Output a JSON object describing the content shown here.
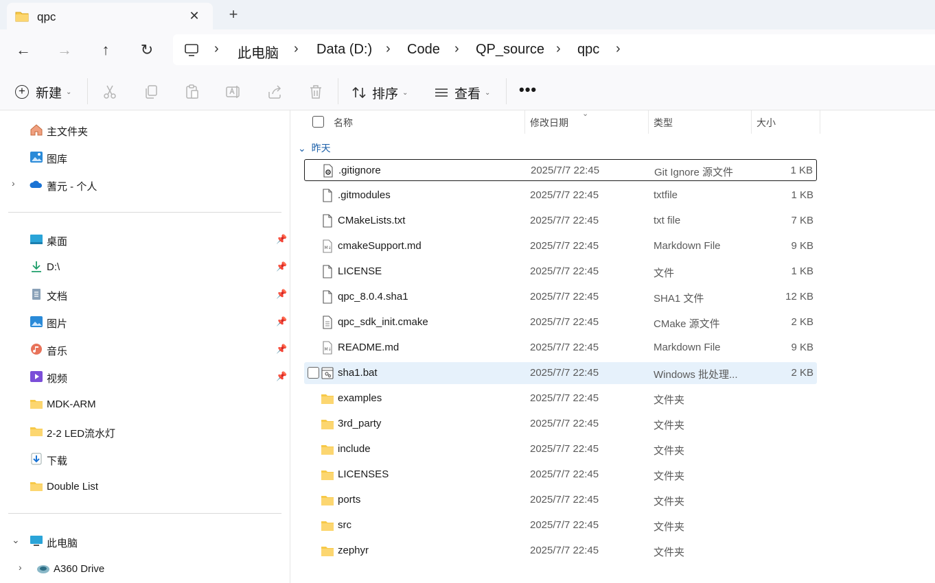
{
  "tab": {
    "title": "qpc",
    "close": "✕",
    "new": "+"
  },
  "nav": {
    "back": "←",
    "forward": "→",
    "up": "↑",
    "refresh": "↻"
  },
  "breadcrumbs": [
    "此电脑",
    "Data (D:)",
    "Code",
    "QP_source",
    "qpc"
  ],
  "breadcrumb_separator": "›",
  "commands": {
    "new_label": "新建",
    "sort_label": "排序",
    "view_label": "查看",
    "more": "•••",
    "icons": [
      "cut-icon",
      "copy-icon",
      "paste-icon",
      "rename-icon",
      "share-icon",
      "delete-icon"
    ]
  },
  "sidebar": {
    "top": [
      {
        "label": "主文件夹",
        "icon": "home-icon"
      },
      {
        "label": "图库",
        "icon": "gallery-icon"
      },
      {
        "label": "蓍元 - 个人",
        "icon": "onedrive-icon",
        "expander": "›"
      }
    ],
    "quick": [
      {
        "label": "桌面",
        "icon": "desktop-icon",
        "pinned": true
      },
      {
        "label": "D:\\",
        "icon": "download-arrow-icon",
        "pinned": true
      },
      {
        "label": "文档",
        "icon": "document-icon",
        "pinned": true
      },
      {
        "label": "图片",
        "icon": "pictures-icon",
        "pinned": true
      },
      {
        "label": "音乐",
        "icon": "music-icon",
        "pinned": true
      },
      {
        "label": "视频",
        "icon": "video-icon",
        "pinned": true
      },
      {
        "label": "MDK-ARM",
        "icon": "folder-icon",
        "pinned": false
      },
      {
        "label": "2-2 LED流水灯",
        "icon": "folder-icon",
        "pinned": false
      },
      {
        "label": "下载",
        "icon": "downloads-icon",
        "pinned": false
      },
      {
        "label": "Double List",
        "icon": "folder-icon",
        "pinned": false
      }
    ],
    "this_pc": {
      "label": "此电脑",
      "expander": "⌄"
    },
    "a360": {
      "label": "A360 Drive",
      "expander": "›"
    },
    "pin_glyph": "📌"
  },
  "columns": {
    "name": "名称",
    "date": "修改日期",
    "type": "类型",
    "size": "大小"
  },
  "group_label": "昨天",
  "group_caret": "⌄",
  "files": [
    {
      "name": ".gitignore",
      "date": "2025/7/7 22:45",
      "type": "Git Ignore 源文件",
      "size": "1 KB",
      "icon": "config-file-icon"
    },
    {
      "name": ".gitmodules",
      "date": "2025/7/7 22:45",
      "type": "txtfile",
      "size": "1 KB",
      "icon": "file-icon"
    },
    {
      "name": "CMakeLists.txt",
      "date": "2025/7/7 22:45",
      "type": "txt file",
      "size": "7 KB",
      "icon": "file-icon"
    },
    {
      "name": "cmakeSupport.md",
      "date": "2025/7/7 22:45",
      "type": "Markdown File",
      "size": "9 KB",
      "icon": "markdown-file-icon"
    },
    {
      "name": "LICENSE",
      "date": "2025/7/7 22:45",
      "type": "文件",
      "size": "1 KB",
      "icon": "file-icon"
    },
    {
      "name": "qpc_8.0.4.sha1",
      "date": "2025/7/7 22:45",
      "type": "SHA1 文件",
      "size": "12 KB",
      "icon": "file-icon"
    },
    {
      "name": "qpc_sdk_init.cmake",
      "date": "2025/7/7 22:45",
      "type": "CMake 源文件",
      "size": "2 KB",
      "icon": "text-file-icon"
    },
    {
      "name": "README.md",
      "date": "2025/7/7 22:45",
      "type": "Markdown File",
      "size": "9 KB",
      "icon": "markdown-file-icon"
    },
    {
      "name": "sha1.bat",
      "date": "2025/7/7 22:45",
      "type": "Windows 批处理...",
      "size": "2 KB",
      "icon": "batch-file-icon"
    },
    {
      "name": "examples",
      "date": "2025/7/7 22:45",
      "type": "文件夹",
      "size": "",
      "icon": "folder-icon"
    },
    {
      "name": "3rd_party",
      "date": "2025/7/7 22:45",
      "type": "文件夹",
      "size": "",
      "icon": "folder-icon"
    },
    {
      "name": "include",
      "date": "2025/7/7 22:45",
      "type": "文件夹",
      "size": "",
      "icon": "folder-icon"
    },
    {
      "name": "LICENSES",
      "date": "2025/7/7 22:45",
      "type": "文件夹",
      "size": "",
      "icon": "folder-icon"
    },
    {
      "name": "ports",
      "date": "2025/7/7 22:45",
      "type": "文件夹",
      "size": "",
      "icon": "folder-icon"
    },
    {
      "name": "src",
      "date": "2025/7/7 22:45",
      "type": "文件夹",
      "size": "",
      "icon": "folder-icon"
    },
    {
      "name": "zephyr",
      "date": "2025/7/7 22:45",
      "type": "文件夹",
      "size": "",
      "icon": "folder-icon"
    }
  ],
  "selected_file": ".gitignore",
  "hovered_file": "sha1.bat",
  "colors": {
    "folder": "#f7c948",
    "accent": "#1b5fa8",
    "hover": "#e6f1fb"
  }
}
